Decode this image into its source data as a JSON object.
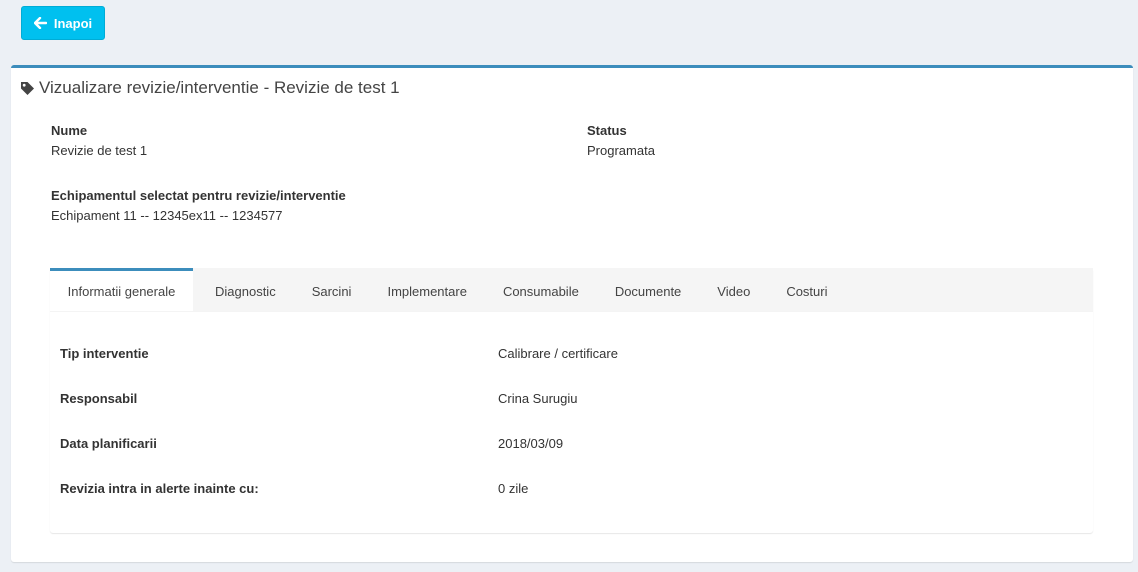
{
  "back_button": {
    "label": "Inapoi",
    "icon": "arrow-left-icon"
  },
  "box": {
    "title": "Vizualizare revizie/interventie - Revizie de test 1",
    "title_icon": "tag-icon",
    "accent_color": "#3c8dbc"
  },
  "fields": {
    "name_label": "Nume",
    "name_value": "Revizie de test 1",
    "status_label": "Status",
    "status_value": "Programata",
    "equipment_label": "Echipamentul selectat pentru revizie/interventie",
    "equipment_value": "Echipament 11 -- 12345ex11 -- 1234577"
  },
  "tabs": [
    {
      "label": "Informatii generale",
      "active": true
    },
    {
      "label": "Diagnostic",
      "active": false
    },
    {
      "label": "Sarcini",
      "active": false
    },
    {
      "label": "Implementare",
      "active": false
    },
    {
      "label": "Consumabile",
      "active": false
    },
    {
      "label": "Documente",
      "active": false
    },
    {
      "label": "Video",
      "active": false
    },
    {
      "label": "Costuri",
      "active": false
    }
  ],
  "general_info": [
    {
      "label": "Tip interventie",
      "value": "Calibrare / certificare"
    },
    {
      "label": "Responsabil",
      "value": "Crina Surugiu"
    },
    {
      "label": "Data planificarii",
      "value": "2018/03/09"
    },
    {
      "label": "Revizia intra in alerte inainte cu:",
      "value": "0 zile"
    }
  ]
}
